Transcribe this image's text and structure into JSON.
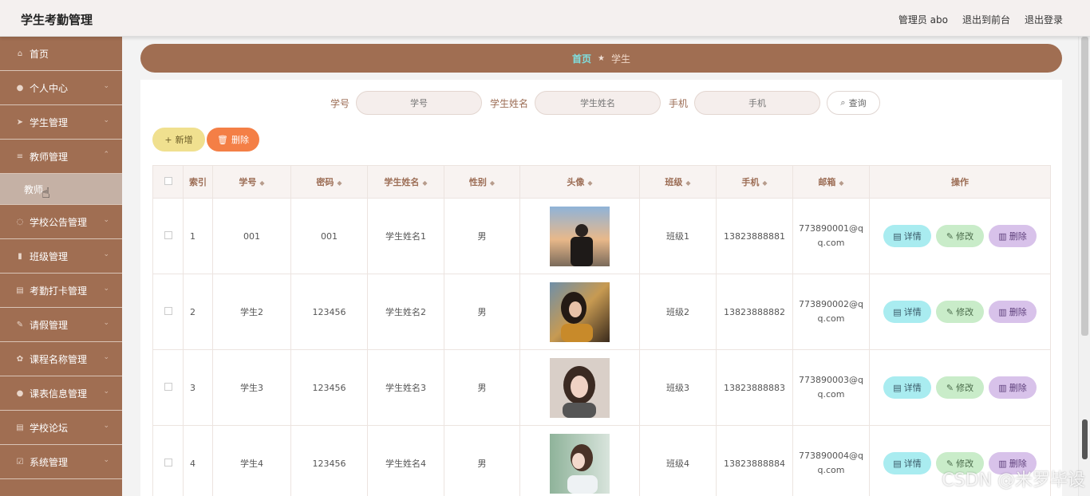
{
  "header": {
    "title": "学生考勤管理",
    "admin": "管理员 abo",
    "to_front": "退出到前台",
    "logout": "退出登录"
  },
  "sidebar": {
    "items": [
      {
        "label": "首页",
        "icon": "home-icon",
        "chevron": false
      },
      {
        "label": "个人中心",
        "icon": "user-icon",
        "chevron": true
      },
      {
        "label": "学生管理",
        "icon": "send-icon",
        "chevron": true
      },
      {
        "label": "教师管理",
        "icon": "list-icon",
        "chevron": true
      }
    ],
    "active_sub": "教师",
    "items_after": [
      {
        "label": "学校公告管理",
        "icon": "bulb-icon",
        "chevron": true
      },
      {
        "label": "班级管理",
        "icon": "bar-chart-icon",
        "chevron": true
      },
      {
        "label": "考勤打卡管理",
        "icon": "clipboard-icon",
        "chevron": true
      },
      {
        "label": "请假管理",
        "icon": "leave-icon",
        "chevron": true
      },
      {
        "label": "课程名称管理",
        "icon": "gear-icon",
        "chevron": true
      },
      {
        "label": "课表信息管理",
        "icon": "location-icon",
        "chevron": true
      },
      {
        "label": "学校论坛",
        "icon": "forum-icon",
        "chevron": true
      },
      {
        "label": "系统管理",
        "icon": "settings-icon",
        "chevron": true
      }
    ]
  },
  "breadcrumb": {
    "home": "首页",
    "current": "学生"
  },
  "search": {
    "student_id_label": "学号",
    "student_id_placeholder": "学号",
    "name_label": "学生姓名",
    "name_placeholder": "学生姓名",
    "phone_label": "手机",
    "phone_placeholder": "手机",
    "query_label": "查询"
  },
  "actions": {
    "add_label": "新增",
    "delete_label": "删除"
  },
  "table": {
    "columns": [
      "索引",
      "学号",
      "密码",
      "学生姓名",
      "性别",
      "头像",
      "班级",
      "手机",
      "邮箱",
      "操作"
    ],
    "rows": [
      {
        "index": "1",
        "student_id": "001",
        "password": "001",
        "name": "学生姓名1",
        "gender": "男",
        "class": "班级1",
        "phone": "13823888881",
        "email": "773890001@qq.com"
      },
      {
        "index": "2",
        "student_id": "学生2",
        "password": "123456",
        "name": "学生姓名2",
        "gender": "男",
        "class": "班级2",
        "phone": "13823888882",
        "email": "773890002@qq.com"
      },
      {
        "index": "3",
        "student_id": "学生3",
        "password": "123456",
        "name": "学生姓名3",
        "gender": "男",
        "class": "班级3",
        "phone": "13823888883",
        "email": "773890003@qq.com"
      },
      {
        "index": "4",
        "student_id": "学生4",
        "password": "123456",
        "name": "学生姓名4",
        "gender": "男",
        "class": "班级4",
        "phone": "13823888884",
        "email": "773890004@qq.com"
      }
    ],
    "ops": {
      "detail": "详情",
      "edit": "修改",
      "delete": "删除"
    }
  },
  "watermark": "CSDN @米罗毕设",
  "colors": {
    "brand": "#a06e52",
    "sidebar_sub": "#c5b1a5",
    "add": "#f0e08f",
    "delete": "#f47f46"
  }
}
